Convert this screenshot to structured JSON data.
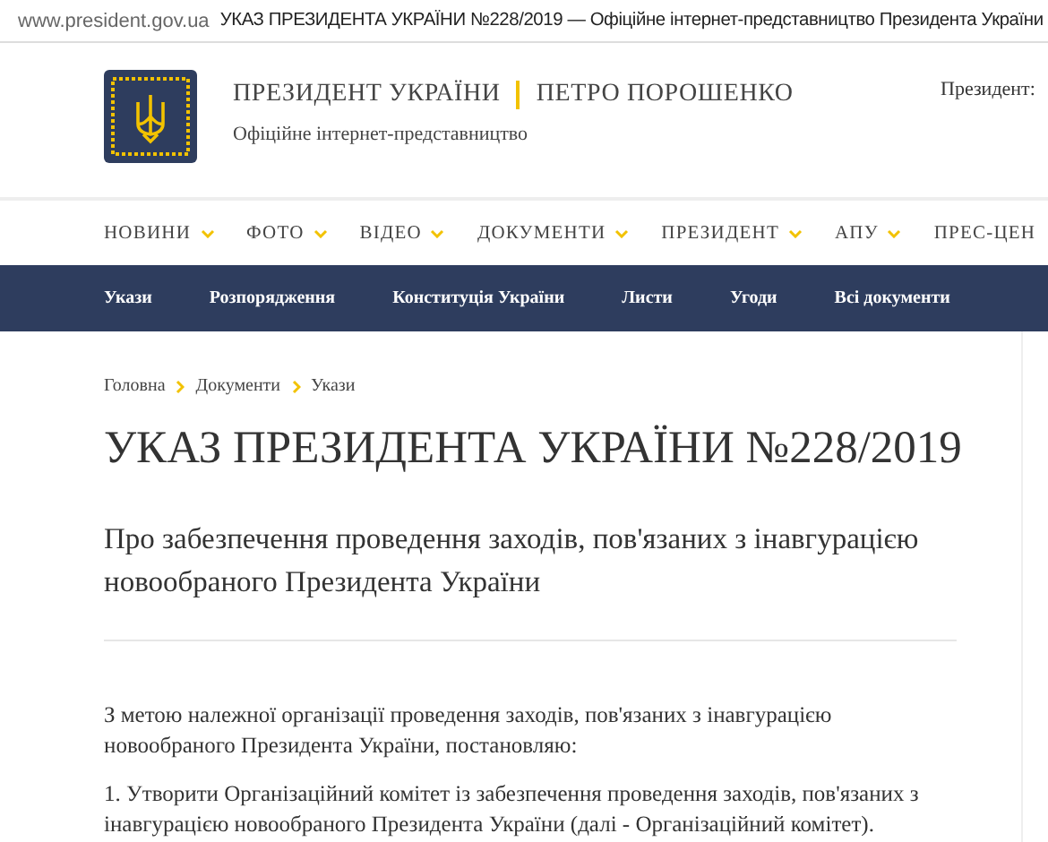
{
  "browser": {
    "url": "www.president.gov.ua",
    "page_title": "УКАЗ ПРЕЗИДЕНТА УКРАЇНИ №228/2019 — Офіційне інтернет-представництво Президента України"
  },
  "header": {
    "title": "ПРЕЗИДЕНТ УКРАЇНИ",
    "name": "ПЕТРО ПОРОШЕНКО",
    "subtitle": "Офіційне інтернет-представництво",
    "president_label": "Президент:"
  },
  "main_nav": [
    "НОВИНИ",
    "ФОТО",
    "ВІДЕО",
    "ДОКУМЕНТИ",
    "ПРЕЗИДЕНТ",
    "АПУ",
    "ПРЕС-ЦЕН"
  ],
  "sub_nav": [
    "Укази",
    "Розпорядження",
    "Конституція України",
    "Листи",
    "Угоди",
    "Всі документи"
  ],
  "breadcrumbs": [
    "Головна",
    "Документи",
    "Укази"
  ],
  "document": {
    "title": "УКАЗ ПРЕЗИДЕНТА УКРАЇНИ №228/2019",
    "subtitle": "Про забезпечення проведення заходів, пов'язаних з інавгурацією новообраного Президента України",
    "paragraphs": [
      "З метою належної організації проведення заходів, пов'язаних з інавгурацією новообраного Президента України, постановляю:",
      "1. Утворити Організаційний комітет із забезпечення проведення заходів, пов'язаних з інавгурацією новообраного Президента України (далі - Організаційний комітет)."
    ]
  }
}
